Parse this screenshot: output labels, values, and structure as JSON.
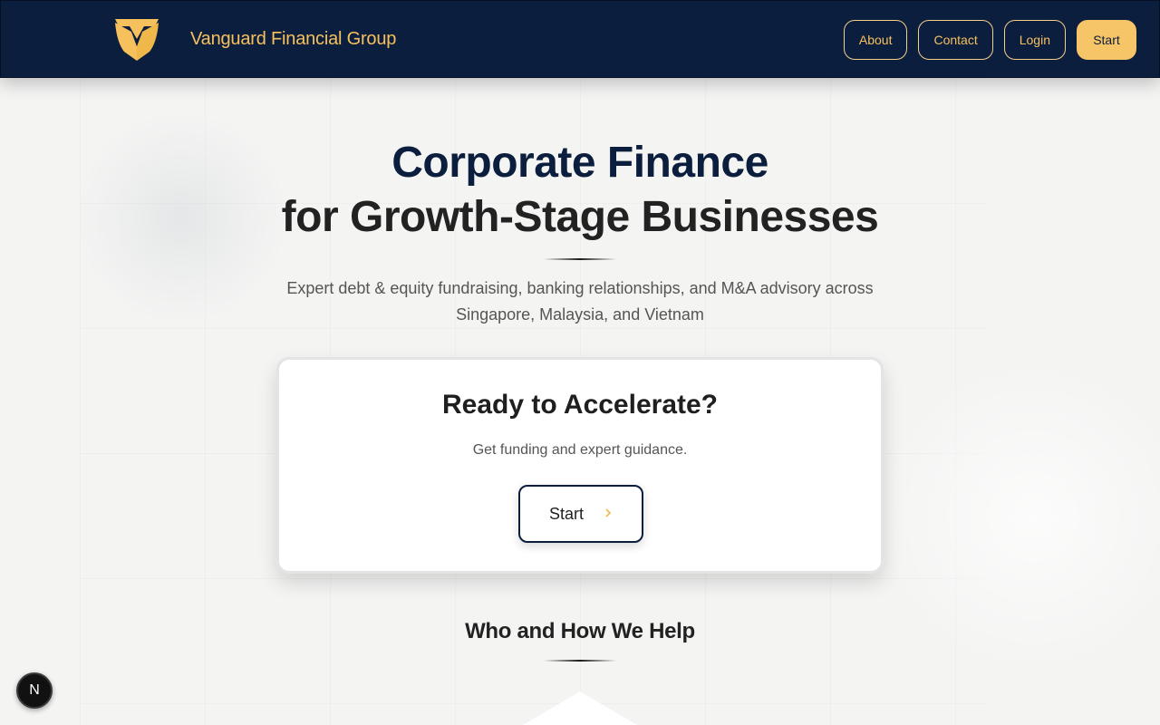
{
  "header": {
    "brand": "Vanguard Financial Group",
    "logo_icon": "vanguard-logo-icon",
    "nav": {
      "about": "About",
      "contact": "Contact",
      "login": "Login",
      "start": "Start"
    }
  },
  "hero": {
    "title_line1": "Corporate Finance",
    "title_line2": "for Growth-Stage Businesses",
    "subtitle_line1": "Expert debt & equity fundraising, banking relationships, and M&A advisory across",
    "subtitle_line2": "Singapore, Malaysia, and Vietnam"
  },
  "cta": {
    "title": "Ready to Accelerate?",
    "subtitle": "Get funding and expert guidance.",
    "button_label": "Start",
    "button_icon": "chevron-right-icon"
  },
  "section": {
    "title": "Who and How We Help"
  },
  "dev_badge": {
    "label": "N"
  },
  "colors": {
    "navy": "#0c1e3e",
    "gold": "#f6c05d",
    "background": "#f4f4f3"
  }
}
